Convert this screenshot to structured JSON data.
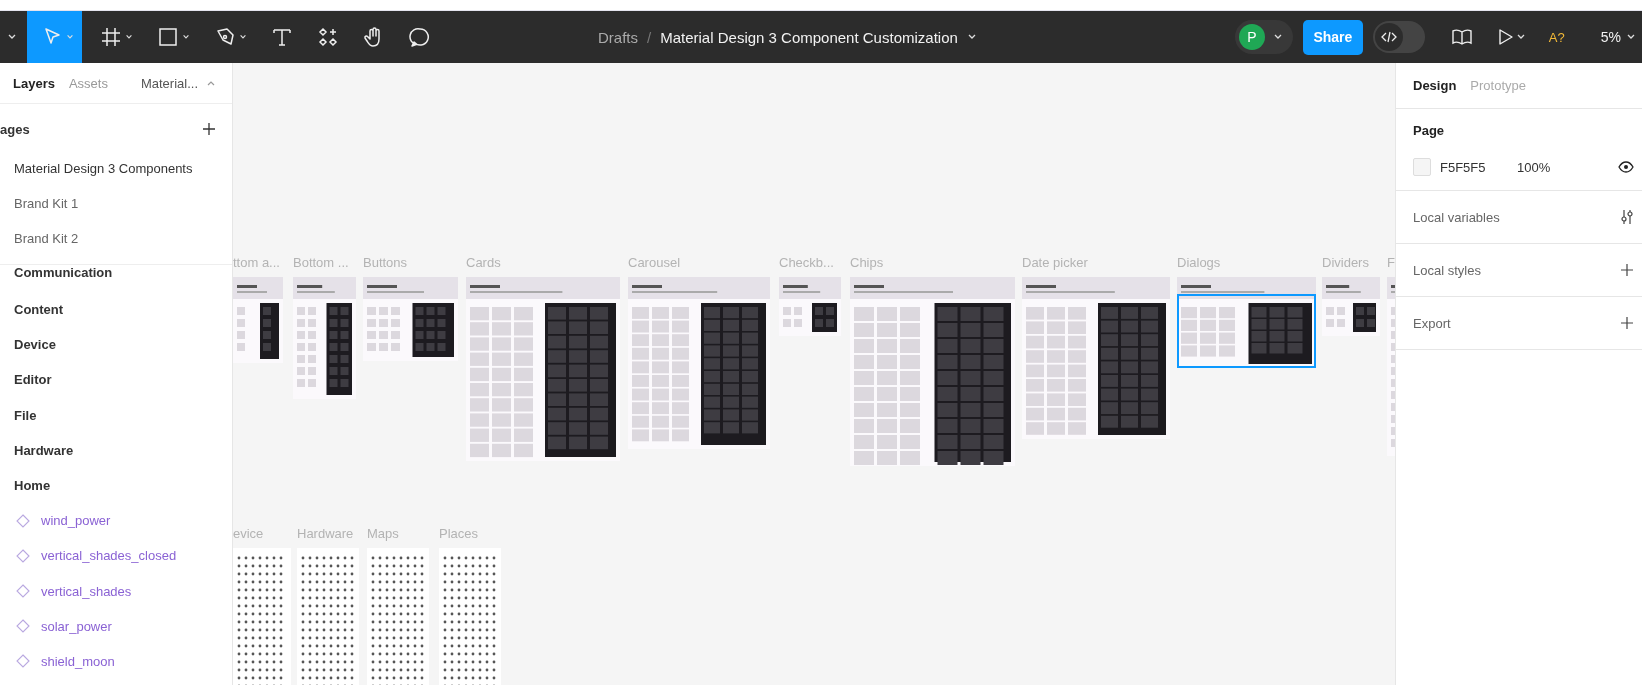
{
  "toolbar": {
    "tools": [
      {
        "selected": true
      },
      {
        "selected": false
      },
      {
        "selected": false
      },
      {
        "selected": false
      },
      {
        "selected": false
      },
      {
        "selected": false
      },
      {
        "selected": false
      },
      {
        "selected": false
      }
    ]
  },
  "breadcrumb": {
    "folder": "Drafts",
    "separator": "/",
    "file": "Material Design 3 Component Customization"
  },
  "user": {
    "initial": "P"
  },
  "share": "Share",
  "dev_mode": {
    "on": false
  },
  "accessibility": "A?",
  "zoom": "5%",
  "left_panel": {
    "tabs": [
      {
        "label": "Layers",
        "selected": true
      },
      {
        "label": "Assets",
        "selected": false
      }
    ],
    "page_menu": "Material...",
    "pages_heading": "ages",
    "pages": [
      {
        "label": "Material Design 3 Components",
        "selected": true
      },
      {
        "label": "Brand Kit 1",
        "selected": false
      },
      {
        "label": "Brand Kit 2",
        "selected": false
      }
    ],
    "layers": [
      {
        "kind": "frame",
        "label": "Communication"
      },
      {
        "kind": "frame",
        "label": "Content"
      },
      {
        "kind": "frame",
        "label": "Device"
      },
      {
        "kind": "frame",
        "label": "Editor"
      },
      {
        "kind": "frame",
        "label": "File"
      },
      {
        "kind": "frame",
        "label": "Hardware"
      },
      {
        "kind": "frame",
        "label": "Home"
      },
      {
        "kind": "component",
        "label": "wind_power"
      },
      {
        "kind": "component",
        "label": "vertical_shades_closed"
      },
      {
        "kind": "component",
        "label": "vertical_shades"
      },
      {
        "kind": "component",
        "label": "solar_power"
      },
      {
        "kind": "component",
        "label": "shield_moon"
      }
    ]
  },
  "canvas": {
    "frames": [
      {
        "label": "ttom a...",
        "kind": "components",
        "selected": false
      },
      {
        "label": "Bottom ...",
        "kind": "components",
        "selected": false
      },
      {
        "label": "Buttons",
        "kind": "components",
        "selected": false
      },
      {
        "label": "Cards",
        "kind": "components",
        "selected": false
      },
      {
        "label": "Carousel",
        "kind": "components",
        "selected": false
      },
      {
        "label": "Checkb...",
        "kind": "components",
        "selected": false
      },
      {
        "label": "Chips",
        "kind": "components",
        "selected": false
      },
      {
        "label": "Date picker",
        "kind": "components",
        "selected": false
      },
      {
        "label": "Dialogs",
        "kind": "components",
        "selected": true
      },
      {
        "label": "Dividers",
        "kind": "components",
        "selected": false
      },
      {
        "label": "F",
        "kind": "components",
        "selected": false
      },
      {
        "label": "evice",
        "kind": "icons",
        "selected": false
      },
      {
        "label": "Hardware",
        "kind": "icons",
        "selected": false
      },
      {
        "label": "Maps",
        "kind": "icons",
        "selected": false
      },
      {
        "label": "Places",
        "kind": "icons",
        "selected": false
      }
    ]
  },
  "right_panel": {
    "tabs": [
      {
        "label": "Design",
        "selected": true
      },
      {
        "label": "Prototype",
        "selected": false
      }
    ],
    "page_heading": "Page",
    "page_color": "F5F5F5",
    "page_opacity": "100%",
    "sections": [
      {
        "label": "Local variables",
        "kind": "variables"
      },
      {
        "label": "Local styles",
        "kind": "add"
      },
      {
        "label": "Export",
        "kind": "add"
      }
    ]
  }
}
